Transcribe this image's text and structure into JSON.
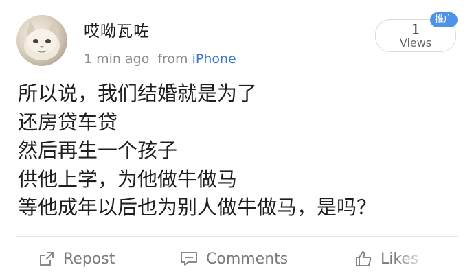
{
  "user": {
    "name": "哎呦瓦咗",
    "avatar_icon": "cat-avatar"
  },
  "meta": {
    "time": "1 min ago",
    "from_label": "from",
    "source": "iPhone"
  },
  "stats": {
    "views_count": "1",
    "views_label": "Views",
    "promo_badge": "推广"
  },
  "post": {
    "lines": [
      "所以说，我们结婚就是为了",
      "还房贷车贷",
      "然后再生一个孩子",
      "供他上学，为他做牛做马",
      "等他成年以后也为别人做牛做马，是吗？"
    ]
  },
  "actions": {
    "repost_label": "Repost",
    "comments_label": "Comments",
    "likes_label": "Likes"
  },
  "colors": {
    "link_blue": "#3a79c7",
    "badge_blue": "#4f93e8",
    "muted_gray": "#8c8c8c"
  }
}
